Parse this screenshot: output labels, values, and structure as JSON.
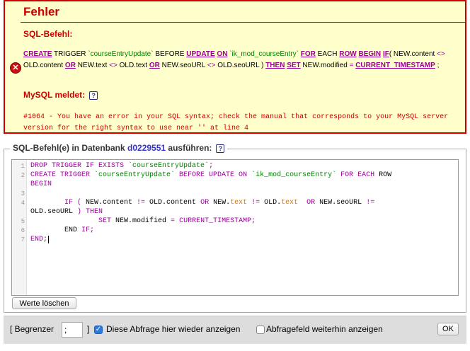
{
  "error": {
    "title": "Fehler",
    "sql_label": "SQL-Befehl:",
    "mysql_label": "MySQL meldet:",
    "message": "#1064 - You have an error in your SQL syntax; check the manual that corresponds to your MySQL server version for the right syntax to use near '' at line 4",
    "sql": {
      "l1_create": "CREATE",
      "l1_trigger": " TRIGGER ",
      "l1_name": "`courseEntryUpdate`",
      "l1_before": " BEFORE ",
      "l1_update": "UPDATE",
      "l1_on": "ON",
      "l1_table": "`ik_mod_courseEntry`",
      "l1_for": "FOR",
      "l1_each": " EACH ",
      "l1_row": "ROW",
      "l1_begin": "BEGIN",
      "l1_if": "IF",
      "l1_paren": "( NEW.content ",
      "op_ne": "<>",
      "l2_old_content": "OLD.content ",
      "or": "OR",
      "l2_new_text": " NEW.text ",
      "l2_old_text": " OLD.text ",
      "l2_new_seourl": " NEW.seoURL ",
      "l2_old_seourl": " OLD.seoURL ) ",
      "then": "THEN",
      "set": "SET",
      "l2_new_modified": " NEW.modified ",
      "eq": "=",
      "current_timestamp": "CURRENT_TIMESTAMP",
      "semicolon": " ;"
    }
  },
  "query_box": {
    "legend_prefix": "SQL-Befehl(e) in Datenbank ",
    "database": "d0229551",
    "legend_suffix": " ausführen:",
    "line_numbers": [
      "1",
      "2",
      "3",
      "4",
      "5",
      "6",
      "7"
    ],
    "code": {
      "l1a": "DROP TRIGGER IF EXISTS ",
      "l1b": "`courseEntryUpdate`",
      "l1c": ";",
      "l2a": "CREATE TRIGGER ",
      "l2b": "`courseEntryUpdate`",
      "l2c": " BEFORE UPDATE ON ",
      "l2d": "`ik_mod_courseEntry`",
      "l2e": " FOR EACH ",
      "l2f": "ROW",
      "l3": "BEGIN",
      "l4a": "        IF ( ",
      "l4b": "NEW.content ",
      "l4c": "!=",
      "l4d": " OLD.content ",
      "l4e": "OR",
      "l4f": " NEW.",
      "l4g": "text",
      "l4h": " != ",
      "l4i": "OLD.",
      "l4j": "text",
      "l4k": "  OR",
      "l4l": " NEW.seoURL ",
      "l4m": "!=",
      "l5a": "OLD.seoURL ",
      "l5b": ") THEN",
      "l6a": "                SET ",
      "l6b": "NEW.modified ",
      "l6c": "=",
      "l6d": " CURRENT_TIMESTAMP",
      "l6e": ";",
      "l7a": "        END ",
      "l7b": "IF;",
      "l8a": "END",
      "l8b": ";"
    },
    "clear_button": "Werte löschen"
  },
  "footer": {
    "delimiter_label_open": "[ Begrenzer",
    "delimiter_value": ";",
    "delimiter_label_close": "]",
    "show_query_label": "Diese Abfrage hier wieder anzeigen",
    "show_query_checked": true,
    "keep_field_label": "Abfragefeld weiterhin anzeigen",
    "keep_field_checked": false,
    "ok_button": "OK"
  }
}
